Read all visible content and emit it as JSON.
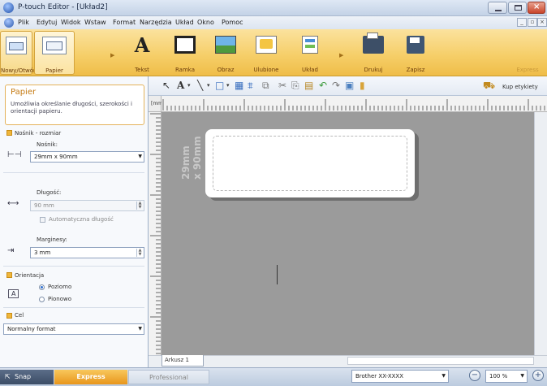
{
  "window": {
    "title": "P-touch Editor - [Układ2]"
  },
  "menu": {
    "items": [
      "Plik",
      "Edytuj",
      "Widok",
      "Wstaw",
      "Format",
      "Narzędzia",
      "Układ",
      "Okno",
      "Pomoc"
    ]
  },
  "ribbon": {
    "new_open": "Nowy/Otwórz",
    "paper": "Papier",
    "text": "Tekst",
    "frame": "Ramka",
    "image": "Obraz",
    "clipart": "Ulubione",
    "layout": "Układ",
    "print": "Drukuj",
    "save": "Zapisz",
    "express": "Express"
  },
  "toolbar": {
    "buy_labels": "Kup etykiety"
  },
  "paper_panel": {
    "title": "Papier",
    "description": "Umożliwia określanie długości, szerokości i orientacji papieru.",
    "media_section": "Nośnik - rozmiar",
    "media_label": "Nośnik:",
    "media_value": "29mm x 90mm",
    "length_label": "Długość:",
    "length_value": "90 mm",
    "auto_length": "Automatyczna długość",
    "margins_label": "Marginesy:",
    "margins_value": "3 mm",
    "orientation_section": "Orientacja",
    "landscape": "Poziomo",
    "portrait": "Pionowo",
    "purpose_section": "Cel",
    "purpose_value": "Normalny format"
  },
  "canvas": {
    "ruler_unit": "[mm]",
    "size_line1": "29mm",
    "size_line2": "x 90mm"
  },
  "sheet": {
    "tab": "Arkusz 1"
  },
  "status": {
    "snap": "Snap",
    "express": "Express",
    "professional": "Professional",
    "printer": "Brother XX-XXXX",
    "zoom": "100 %"
  },
  "colors": {
    "ribbon": "#f6cf6a",
    "express_accent": "#e8961c",
    "panel_accent": "#f0b63a"
  },
  "icons": [
    "app-icon",
    "new-open-icon",
    "paper-icon",
    "text-icon",
    "frame-icon",
    "image-icon",
    "clipart-icon",
    "layout-icon",
    "print-icon",
    "save-icon"
  ]
}
